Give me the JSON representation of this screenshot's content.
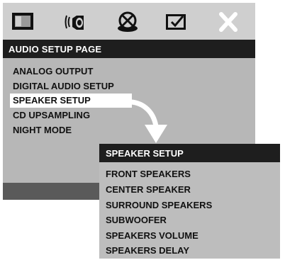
{
  "toolbar": {
    "icons": [
      "general-setup-icon",
      "audio-setup-icon",
      "dolby-setup-icon",
      "preference-setup-icon",
      "exit-icon"
    ]
  },
  "main": {
    "title": "AUDIO SETUP PAGE",
    "items": [
      {
        "label": "ANALOG OUTPUT"
      },
      {
        "label": "DIGITAL AUDIO SETUP"
      },
      {
        "label": "SPEAKER SETUP",
        "selected": true
      },
      {
        "label": "CD UPSAMPLING"
      },
      {
        "label": "NIGHT MODE"
      }
    ]
  },
  "submenu": {
    "title": "SPEAKER SETUP",
    "items": [
      {
        "label": "FRONT SPEAKERS"
      },
      {
        "label": "CENTER SPEAKER"
      },
      {
        "label": "SURROUND SPEAKERS"
      },
      {
        "label": "SUBWOOFER"
      },
      {
        "label": "SPEAKERS VOLUME"
      },
      {
        "label": "SPEAKERS DELAY"
      }
    ]
  },
  "colors": {
    "panel": "#b7b7b7",
    "title_bar": "#1e1e1e",
    "selected_bg": "#ffffff"
  }
}
